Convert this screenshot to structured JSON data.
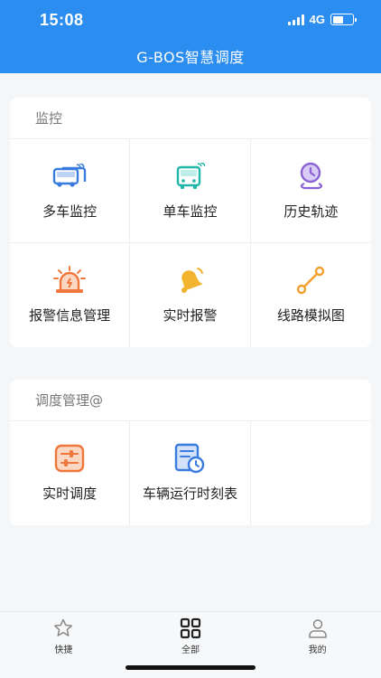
{
  "status_bar": {
    "time": "15:08",
    "network": "4G",
    "battery_level": 0.55
  },
  "header": {
    "title": "G-BOS智慧调度"
  },
  "sections": [
    {
      "title": "监控",
      "items": [
        {
          "label": "多车监控",
          "icon": "multi-bus-icon",
          "color": "#3a7be0"
        },
        {
          "label": "单车监控",
          "icon": "single-bus-icon",
          "color": "#1fb8a8"
        },
        {
          "label": "历史轨迹",
          "icon": "history-track-icon",
          "color": "#8a62d6"
        },
        {
          "label": "报警信息管理",
          "icon": "alarm-light-icon",
          "color": "#f0773c"
        },
        {
          "label": "实时报警",
          "icon": "bell-icon",
          "color": "#f2b42e"
        },
        {
          "label": "线路模拟图",
          "icon": "route-line-icon",
          "color": "#f2a12e"
        }
      ]
    },
    {
      "title": "调度管理@",
      "items": [
        {
          "label": "实时调度",
          "icon": "sliders-icon",
          "color": "#f0773c"
        },
        {
          "label": "车辆运行时刻表",
          "icon": "timetable-icon",
          "color": "#3a7be0"
        }
      ]
    }
  ],
  "tabbar": {
    "items": [
      {
        "label": "快捷",
        "icon": "star-icon",
        "active": false
      },
      {
        "label": "全部",
        "icon": "grid-icon",
        "active": true
      },
      {
        "label": "我的",
        "icon": "user-icon",
        "active": false
      }
    ]
  }
}
